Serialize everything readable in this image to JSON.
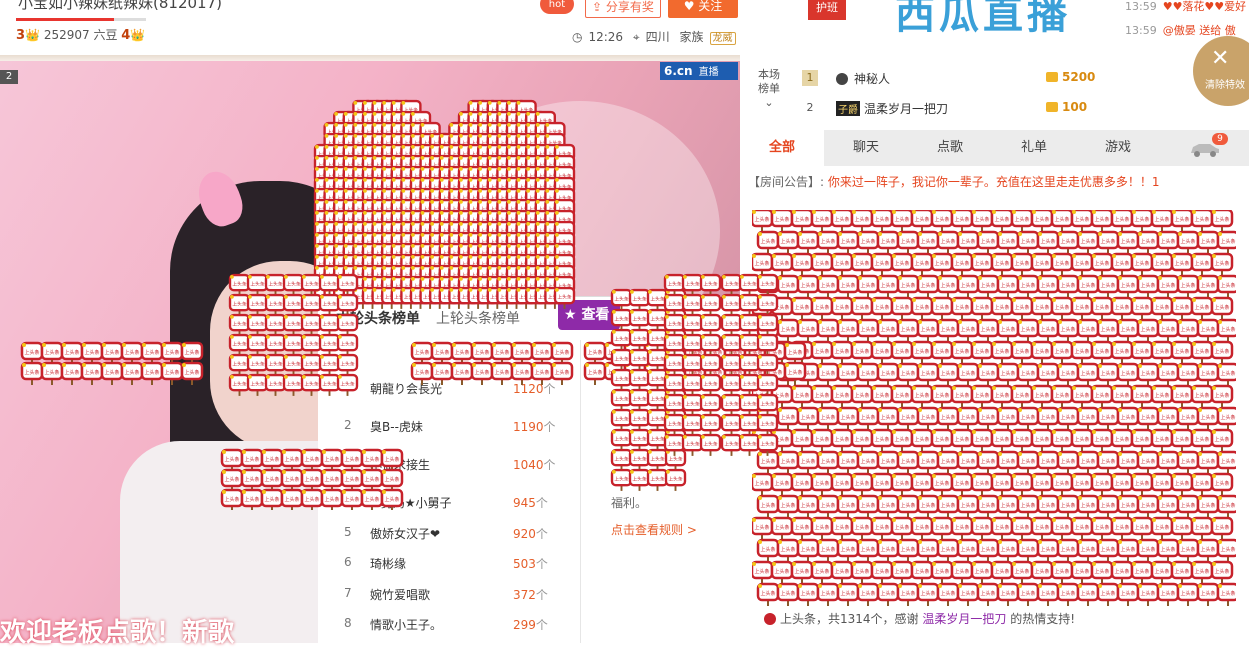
{
  "header": {
    "title": "小宝如小辣妹纸辣妹(812017)",
    "stats": {
      "level_left": "3",
      "beans": "252907 六豆",
      "level_right": "4"
    },
    "progress": 0.75,
    "hot_label": "hot",
    "share_label": "分享有奖",
    "follow_label": "关注",
    "time": "12:26",
    "location": "四川",
    "family_label": "家族",
    "family_tag": "龙威"
  },
  "video": {
    "room_badge": "2",
    "logo_text": "6.cn",
    "live_label": "直播",
    "welcome_text": "欢迎老板点歌！新歌"
  },
  "headline_panel": {
    "tab_this_round": "本轮头条榜单",
    "tab_last_round": "上轮头条榜单",
    "view_button": "查看",
    "unit": "个",
    "rows": [
      {
        "rank": "1",
        "name": "朝龍り会長光",
        "count": "1120"
      },
      {
        "rank": "2",
        "name": "臭B--虎妹",
        "count": "1190"
      },
      {
        "rank": "3",
        "name": "小仙求接生",
        "count": "1040"
      },
      {
        "rank": "4",
        "name": "★舅妈★小舅子",
        "count": "945"
      },
      {
        "rank": "5",
        "name": "傲娇女汉子❤",
        "count": "920"
      },
      {
        "rank": "6",
        "name": "琦彬缘",
        "count": "503"
      },
      {
        "rank": "7",
        "name": "婉竹爱唱歌",
        "count": "372"
      },
      {
        "rank": "8",
        "name": "情歌小王子。",
        "count": "299"
      }
    ],
    "tip": "福利。",
    "rules_link": "点击查看规则 >"
  },
  "right_top": {
    "guard_label": "护班",
    "banner_text": "西瓜直播",
    "ticker": [
      {
        "time": "13:59",
        "text": "♥♥落花♥♥爱好"
      },
      {
        "time": "13:59",
        "text": "@傲晏 送给 傲"
      }
    ],
    "clear_effects": "清除特效"
  },
  "rank": {
    "label": "本场榜单",
    "rows": [
      {
        "rank": "1",
        "name": "神秘人",
        "coins": "5200"
      },
      {
        "rank": "2",
        "badge": "子爵",
        "name": "温柔岁月一把刀",
        "coins": "100"
      }
    ]
  },
  "chat": {
    "tabs": [
      "全部",
      "聊天",
      "点歌",
      "礼单",
      "游戏"
    ],
    "car_badge": "9",
    "notice_label": "【房间公告】:",
    "notice_text": "你来过一阵子，我记你一辈子。充值在这里走走优惠多多！！1",
    "sign_text": "上头条",
    "footer_prefix": "上头条，共1314个，感谢",
    "footer_name": "温柔岁月一把刀",
    "footer_suffix": "的热情支持!"
  },
  "colors": {
    "accent": "#e5451f",
    "sign_red": "#c7222b",
    "purple": "#8e2aa8"
  }
}
